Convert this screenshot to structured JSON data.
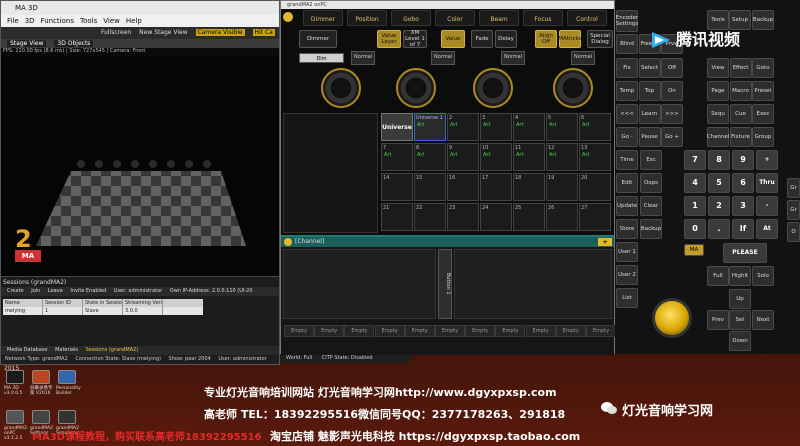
{
  "ma3d": {
    "title": "MA 3D",
    "menu": [
      "File",
      "3D",
      "Functions",
      "Tools",
      "View",
      "Help"
    ],
    "toolbar": [
      "Fullscreen",
      "New Stage View",
      "Camera Visible",
      "Hit Ca"
    ],
    "tabs": [
      "Stage View",
      "3D Objects"
    ],
    "fps": "FPS: 110.00 fps (8.6 ms) | Size: 727x545 | Camera: Front",
    "sessions_title": "Sessions (grandMA2)",
    "sessions_bar": [
      "Create",
      "Join",
      "Leave",
      "Invite Enabled",
      "User: administrator",
      "Own IP-Address: 2.0.0.110 (UI-20"
    ],
    "table_headers": [
      "Name",
      "Session ID",
      "State in Session",
      "Streaming Version"
    ],
    "table_rows": [
      [
        "meiying",
        "1",
        "Slave",
        "3.0.0"
      ]
    ],
    "bottom_tabs": [
      "Media Database",
      "Materials",
      "Sessions (grandMA2)"
    ],
    "status": [
      "Network Type: grandMA2",
      "Connection State: Slave (meiying)",
      "Show: pear 2004",
      "User: administrator"
    ]
  },
  "gma": {
    "title": "grandMA2 onPC",
    "preset_tabs": [
      "Dimmer",
      "Position",
      "Gobo",
      "Color",
      "Beam",
      "Focus",
      "Control"
    ],
    "row2": [
      "Dimmer",
      "Value Layer",
      "XM Level 1 of 7",
      "Value",
      "Fade",
      "Delay",
      "Align Off",
      "MAtricks",
      "Special Dialog"
    ],
    "dim_label": "Dim",
    "normal_labels": [
      "Normal",
      "Normal",
      "Normal",
      "Normal"
    ],
    "universe_label": "Universe",
    "universe_first": "Universe 1",
    "art_label": "Art",
    "status_right": [
      "World: Full",
      "CITP State: Disabled"
    ],
    "channel_title": "[Channel]",
    "button_label": "Button 1",
    "empty_label": "Empty"
  },
  "console": {
    "top": [
      "Encoder Settings",
      "Tools",
      "Setup",
      "Backup"
    ],
    "r1": [
      "Blind",
      "Freeze",
      "Prvw"
    ],
    "keys_a": [
      "Fix",
      "Select",
      "Off",
      "Temp",
      "Top",
      "On",
      "<<<",
      "Learn",
      ">>>",
      "Go -",
      "Pause",
      "Go +"
    ],
    "keys_b": [
      "View",
      "Effect",
      "Goto",
      "Page",
      "Macro",
      "Preset",
      "Sequ",
      "Cue",
      "Exec",
      "Channel",
      "Fixture",
      "Group"
    ],
    "keys_c": [
      "Time",
      "Esc",
      "Edit",
      "Oops",
      "Update",
      "Clear",
      "Store",
      "Backup",
      "User 1",
      "User 2",
      "List"
    ],
    "numpad": [
      "7",
      "8",
      "9",
      "+",
      "4",
      "5",
      "6",
      "Thru",
      "1",
      "2",
      "3",
      "-",
      "0",
      ".",
      "If",
      "At"
    ],
    "extra": [
      "MA",
      "PLEASE",
      "Full",
      "Highlt",
      "Solo",
      "Up",
      "Prev",
      "Set",
      "Next",
      "Down"
    ],
    "colorizer": [
      "Gr",
      "Gr",
      "O"
    ]
  },
  "tencent": "腾讯视频",
  "overlay": {
    "line1": "专业灯光音响培训网站  灯光音响学习网http://www.dgyxpxsp.com",
    "line2": "高老师 TEL：18392295516微信同号QQ：2377178263、291818",
    "line3": "淘宝店铺 魅影声光电科技 https://dgyxpxsp.taobao.com",
    "red": "MA3D课程教程，购买联系高老师18392295516",
    "year": "2015",
    "watermark": "灯光音响学习网"
  },
  "taskbar_icons": [
    {
      "label": "MA 3D v3.0.0.5",
      "color": "#1a1a1a"
    },
    {
      "label": "屏幕录像专家 V2016",
      "color": "#b42"
    },
    {
      "label": "Personality Builder",
      "color": "#36a"
    },
    {
      "label": "grandMA2 onPC v3.1.2.5",
      "color": "#555"
    },
    {
      "label": "grandMA2 Settings",
      "color": "#444"
    },
    {
      "label": "grandMA2 Simulator",
      "color": "#333"
    }
  ]
}
